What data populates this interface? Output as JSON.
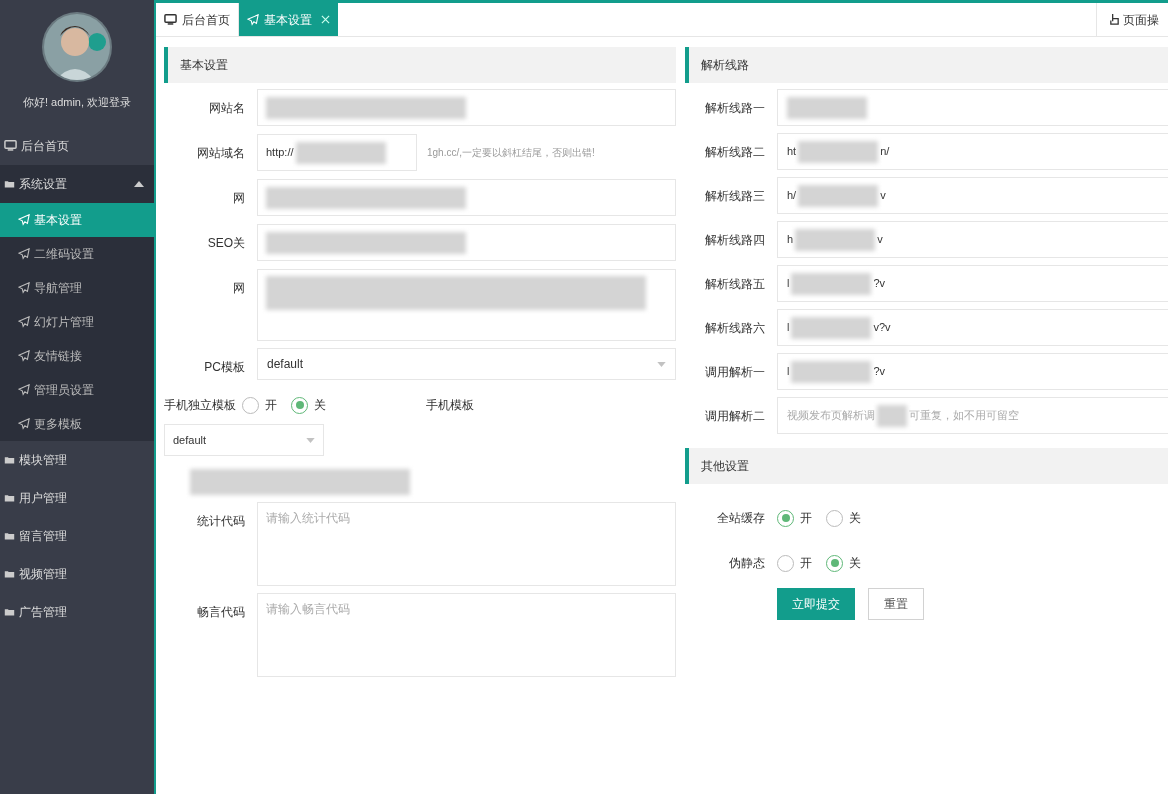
{
  "sidebar": {
    "greeting": "你好! admin, 欢迎登录",
    "items": [
      {
        "label": "后台首页",
        "kind": "home",
        "selected": false
      },
      {
        "label": "系统设置",
        "kind": "group",
        "expanded": true,
        "selected": false,
        "children": [
          {
            "label": "基本设置",
            "selected": true
          },
          {
            "label": "二维码设置",
            "selected": false
          },
          {
            "label": "导航管理",
            "selected": false
          },
          {
            "label": "幻灯片管理",
            "selected": false
          },
          {
            "label": "友情链接",
            "selected": false
          },
          {
            "label": "管理员设置",
            "selected": false
          },
          {
            "label": "更多模板",
            "selected": false
          }
        ]
      },
      {
        "label": "模块管理",
        "kind": "group",
        "expanded": false,
        "selected": false
      },
      {
        "label": "用户管理",
        "kind": "group",
        "expanded": false,
        "selected": false
      },
      {
        "label": "留言管理",
        "kind": "group",
        "expanded": false,
        "selected": false
      },
      {
        "label": "视频管理",
        "kind": "group",
        "expanded": false,
        "selected": false
      },
      {
        "label": "广告管理",
        "kind": "group",
        "expanded": false,
        "selected": false
      }
    ]
  },
  "tabs": [
    {
      "label": "后台首页",
      "kind": "home",
      "selected": false
    },
    {
      "label": "基本设置",
      "kind": "page",
      "selected": true
    }
  ],
  "page_actions": "页面操",
  "basic": {
    "title": "基本设置",
    "rows": [
      {
        "kind": "input",
        "label": "网站名",
        "redacted": true
      },
      {
        "kind": "short",
        "label": "网站域名",
        "prefix": "http://",
        "redacted": true,
        "hint": "1gh.cc/,一定要以斜杠结尾，否则出错!"
      },
      {
        "kind": "input",
        "label": "网",
        "redacted": true
      },
      {
        "kind": "input",
        "label": "SEO关",
        "redacted": true
      },
      {
        "kind": "textarea",
        "label": "网",
        "redacted": true
      },
      {
        "kind": "select",
        "label": "PC模板",
        "value": "default"
      },
      {
        "kind": "radio",
        "label": "手机独立模板",
        "options": [
          {
            "label": "开",
            "selected": false
          },
          {
            "label": "关",
            "selected": true
          }
        ],
        "side_label": "手机模板"
      },
      {
        "kind": "wideselect",
        "value": "default"
      },
      {
        "kind": "blurred",
        "redacted": true
      },
      {
        "kind": "textarea",
        "label": "统计代码",
        "placeholder": "请输入统计代码"
      },
      {
        "kind": "textarea",
        "label": "畅言代码",
        "placeholder": "请输入畅言代码"
      }
    ]
  },
  "routes": {
    "title": "解析线路",
    "rows": [
      {
        "label": "解析线路一",
        "prefix": "",
        "suffix": "",
        "redacted": true
      },
      {
        "label": "解析线路二",
        "prefix": "ht",
        "suffix": "n/",
        "redacted": true
      },
      {
        "label": "解析线路三",
        "prefix": "h/",
        "suffix": "v",
        "redacted": true
      },
      {
        "label": "解析线路四",
        "prefix": "h",
        "suffix": "v",
        "redacted": true
      },
      {
        "label": "解析线路五",
        "prefix": "l",
        "suffix": "?v",
        "redacted": true
      },
      {
        "label": "解析线路六",
        "prefix": "l",
        "suffix": "v?v",
        "redacted": true
      },
      {
        "label": "调用解析一",
        "prefix": "l",
        "suffix": "?v",
        "redacted": true
      },
      {
        "label": "调用解析二",
        "prefix": "视频发布页解析调",
        "suffix": "可重复，如不用可留空",
        "redacted": true,
        "placeholder": true
      }
    ]
  },
  "other": {
    "title": "其他设置",
    "rows": [
      {
        "label": "全站缓存",
        "options": [
          {
            "label": "开",
            "selected": true
          },
          {
            "label": "关",
            "selected": false
          }
        ]
      },
      {
        "label": "伪静态",
        "options": [
          {
            "label": "开",
            "selected": false
          },
          {
            "label": "关",
            "selected": true
          }
        ]
      }
    ],
    "buttons": [
      {
        "label": "立即提交",
        "kind": "primary"
      },
      {
        "label": "重置",
        "kind": "secondary"
      }
    ]
  }
}
